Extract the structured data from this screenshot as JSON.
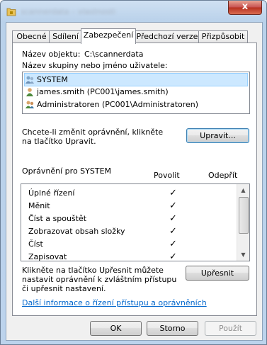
{
  "window": {
    "title": "scannerdata – vlastnosti",
    "close_label": "x"
  },
  "tabs": [
    {
      "label": "Obecné"
    },
    {
      "label": "Sdílení"
    },
    {
      "label": "Zabezpečení"
    },
    {
      "label": "Předchozí verze"
    },
    {
      "label": "Přizpůsobit"
    }
  ],
  "security": {
    "object_name_label": "Název objektu:",
    "object_name_value": "C:\\scannerdata",
    "groups_label": "Název skupiny nebo jméno uživatele:",
    "principals": [
      {
        "name": "SYSTEM",
        "icon": "users-group-icon"
      },
      {
        "name": "james.smith (PC001\\james.smith)",
        "icon": "user-icon"
      },
      {
        "name": "Administratoren (PC001\\Administratoren)",
        "icon": "users-group-icon"
      }
    ],
    "change_hint": "Chcete-li změnit oprávnění, klikněte na tlačítko Upravit.",
    "edit_button": "Upravit...",
    "permissions_for": "Oprávnění pro SYSTEM",
    "allow_header": "Povolit",
    "deny_header": "Odepřít",
    "permissions": [
      {
        "name": "Úplné řízení",
        "allow": "✓",
        "deny": ""
      },
      {
        "name": "Měnit",
        "allow": "✓",
        "deny": ""
      },
      {
        "name": "Číst a spouštět",
        "allow": "✓",
        "deny": ""
      },
      {
        "name": "Zobrazovat obsah složky",
        "allow": "✓",
        "deny": ""
      },
      {
        "name": "Číst",
        "allow": "✓",
        "deny": ""
      },
      {
        "name": "Zapisovat",
        "allow": "✓",
        "deny": ""
      }
    ],
    "advanced_hint": "Klikněte na tlačítko Upřesnit můžete nastavit oprávnění k zvláštním přístupu či upřesnit nastavení.",
    "advanced_button": "Upřesnit",
    "help_link": "Další informace o řízení přístupu a oprávněních"
  },
  "footer": {
    "ok": "OK",
    "cancel": "Storno",
    "apply": "Použít"
  },
  "colors": {
    "selection": "#cce8ff",
    "link": "#0066cc"
  }
}
